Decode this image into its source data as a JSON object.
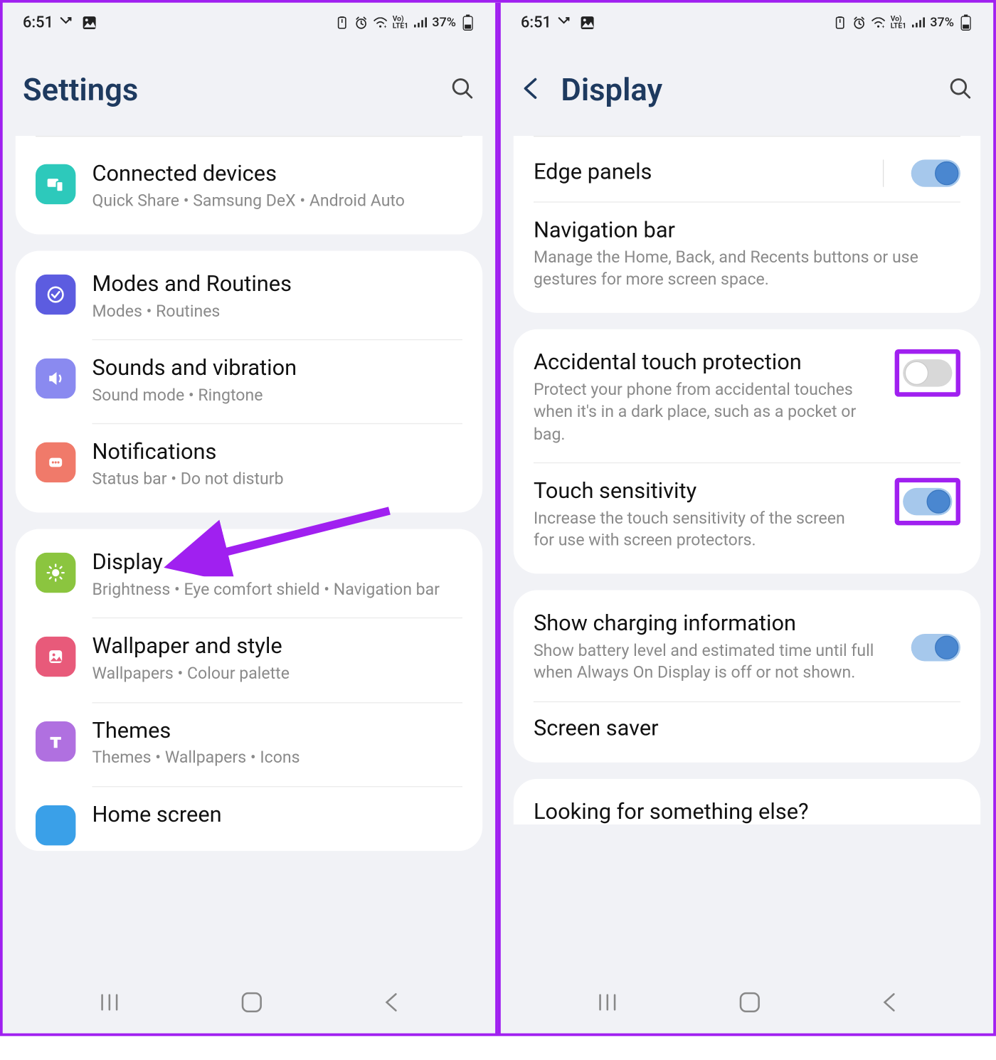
{
  "status": {
    "time": "6:51",
    "battery": "37%"
  },
  "left": {
    "header": "Settings",
    "items": {
      "connected": {
        "title": "Connected devices",
        "sub": "Quick Share  •  Samsung DeX  •  Android Auto"
      },
      "modes": {
        "title": "Modes and Routines",
        "sub": "Modes  •  Routines"
      },
      "sounds": {
        "title": "Sounds and vibration",
        "sub": "Sound mode  •  Ringtone"
      },
      "notif": {
        "title": "Notifications",
        "sub": "Status bar  •  Do not disturb"
      },
      "display": {
        "title": "Display",
        "sub": "Brightness  •  Eye comfort shield  •  Navigation bar"
      },
      "wallpaper": {
        "title": "Wallpaper and style",
        "sub": "Wallpapers  •  Colour palette"
      },
      "themes": {
        "title": "Themes",
        "sub": "Themes  •  Wallpapers  •  Icons"
      },
      "home": {
        "title": "Home screen"
      }
    }
  },
  "right": {
    "header": "Display",
    "items": {
      "edge": {
        "title": "Edge panels"
      },
      "nav": {
        "title": "Navigation bar",
        "sub": "Manage the Home, Back, and Recents buttons or use gestures for more screen space."
      },
      "touch": {
        "title": "Accidental touch protection",
        "sub": "Protect your phone from accidental touches when it's in a dark place, such as a pocket or bag."
      },
      "sens": {
        "title": "Touch sensitivity",
        "sub": "Increase the touch sensitivity of the screen for use with screen protectors."
      },
      "charge": {
        "title": "Show charging information",
        "sub": "Show battery level and estimated time until full when Always On Display is off or not shown."
      },
      "saver": {
        "title": "Screen saver"
      }
    },
    "looking": "Looking for something else?"
  }
}
